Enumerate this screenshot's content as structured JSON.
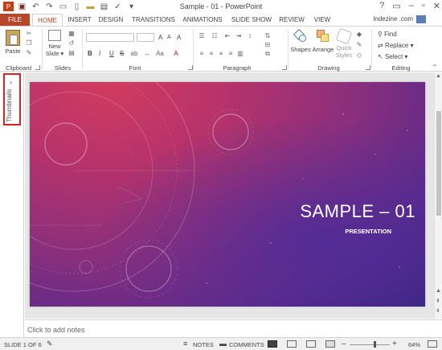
{
  "titlebar": {
    "title": "Sample - 01 - PowerPoint",
    "help": "?",
    "minimize": "–",
    "restore": "▫",
    "close": "✕"
  },
  "tabs": {
    "file": "FILE",
    "items": [
      "HOME",
      "INSERT",
      "DESIGN",
      "TRANSITIONS",
      "ANIMATIONS",
      "SLIDE SHOW",
      "REVIEW",
      "VIEW"
    ],
    "user": "Indezine .com"
  },
  "ribbon": {
    "clipboard": {
      "label": "Clipboard",
      "paste": "Paste"
    },
    "slides": {
      "label": "Slides",
      "new_slide_line1": "New",
      "new_slide_line2": "Slide"
    },
    "font": {
      "label": "Font",
      "bold": "B",
      "italic": "I",
      "underline": "U",
      "strike": "S",
      "grow": "A",
      "shrink": "A",
      "clear": "A"
    },
    "paragraph": {
      "label": "Paragraph"
    },
    "drawing": {
      "label": "Drawing",
      "shapes": "Shapes",
      "arrange": "Arrange",
      "quick_styles_line1": "Quick",
      "quick_styles_line2": "Styles"
    },
    "editing": {
      "label": "Editing",
      "find": "Find",
      "replace": "Replace",
      "select": "Select"
    }
  },
  "thumbnails": {
    "label": "Thumbnails",
    "chevron": "›"
  },
  "slide": {
    "title": "SAMPLE – 01",
    "subtitle": "PRESENTATION"
  },
  "notes": {
    "placeholder": "Click to add notes"
  },
  "status": {
    "slide_info": "SLIDE 1 OF 6",
    "notes": "NOTES",
    "comments": "COMMENTS",
    "zoom_minus": "–",
    "zoom_plus": "+",
    "zoom": "64%"
  },
  "colors": {
    "accent": "#b7472a",
    "highlight_box": "#e02020"
  }
}
